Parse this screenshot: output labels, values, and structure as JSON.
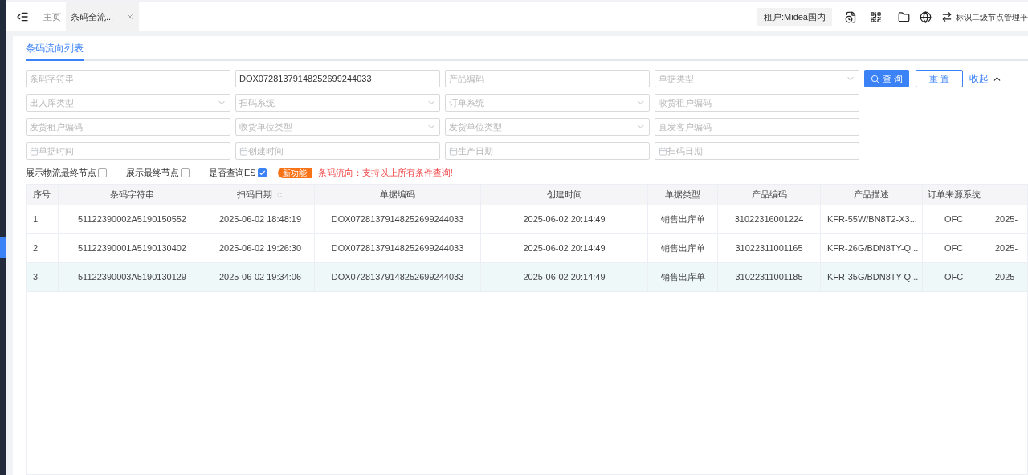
{
  "tabs": [
    {
      "label": "主页",
      "selected": false,
      "closable": false
    },
    {
      "label": "条码全流...",
      "selected": true,
      "closable": true
    }
  ],
  "toolbar": {
    "tenant": "租户:Midea国内",
    "platform": "标识二级节点管理平"
  },
  "page_tabs": [
    {
      "label": "条码流向列表",
      "selected": true
    }
  ],
  "filters": [
    {
      "kind": "input",
      "placeholder": "条码字符串"
    },
    {
      "kind": "input",
      "value": "DOX07281379148252699244033"
    },
    {
      "kind": "input",
      "placeholder": "产品编码"
    },
    {
      "kind": "select",
      "placeholder": "单据类型"
    },
    {
      "kind": "select",
      "placeholder": "出入库类型"
    },
    {
      "kind": "select",
      "placeholder": "扫码系统"
    },
    {
      "kind": "select",
      "placeholder": "订单系统"
    },
    {
      "kind": "input",
      "placeholder": "收货租户编码"
    },
    {
      "kind": "input",
      "placeholder": "发货租户编码"
    },
    {
      "kind": "select",
      "placeholder": "收货单位类型"
    },
    {
      "kind": "select",
      "placeholder": "发货单位类型"
    },
    {
      "kind": "input",
      "placeholder": "直发客户编码"
    },
    {
      "kind": "date",
      "placeholder": "单据时间"
    },
    {
      "kind": "date",
      "placeholder": "创建时间"
    },
    {
      "kind": "date",
      "placeholder": "生产日期"
    },
    {
      "kind": "date",
      "placeholder": "扫码日期"
    }
  ],
  "actions": {
    "search": "查 询",
    "reset": "重 置",
    "collapse": "收起"
  },
  "options": [
    {
      "label": "展示物流最终节点",
      "checked": false
    },
    {
      "label": "展示最终节点",
      "checked": false
    },
    {
      "label": "是否查询ES",
      "checked": true
    }
  ],
  "badge": "新功能",
  "notice": "条码流向：支持以上所有条件查询!",
  "table": {
    "columns": [
      {
        "label": "序号",
        "sortable": false
      },
      {
        "label": "条码字符串",
        "sortable": false
      },
      {
        "label": "扫码日期",
        "sortable": true
      },
      {
        "label": "单据编码",
        "sortable": false
      },
      {
        "label": "创建时间",
        "sortable": false
      },
      {
        "label": "单据类型",
        "sortable": false
      },
      {
        "label": "产品编码",
        "sortable": false
      },
      {
        "label": "产品描述",
        "sortable": false
      },
      {
        "label": "订单来源系统",
        "sortable": false
      },
      {
        "sortable": false
      }
    ],
    "rows": [
      {
        "selected": false,
        "cells": [
          "1",
          "51122390002A5190150552",
          "2025-06-02 18:48:19",
          "DOX07281379148252699244033",
          "2025-06-02 20:14:49",
          "销售出库单",
          "31022316001224",
          "KFR-55W/BN8T2-X3...",
          "OFC",
          "2025-"
        ]
      },
      {
        "selected": false,
        "cells": [
          "2",
          "51122390001A5190130402",
          "2025-06-02 19:26:30",
          "DOX07281379148252699244033",
          "2025-06-02 20:14:49",
          "销售出库单",
          "31022311001165",
          "KFR-26G/BDN8TY-Q...",
          "OFC",
          "2025-"
        ]
      },
      {
        "selected": true,
        "cells": [
          "3",
          "51122390003A5190130129",
          "2025-06-02 19:34:06",
          "DOX07281379148252699244033",
          "2025-06-02 20:14:49",
          "销售出库单",
          "31022311001185",
          "KFR-35G/BDN8TY-Q...",
          "OFC",
          "2025-"
        ]
      }
    ]
  }
}
